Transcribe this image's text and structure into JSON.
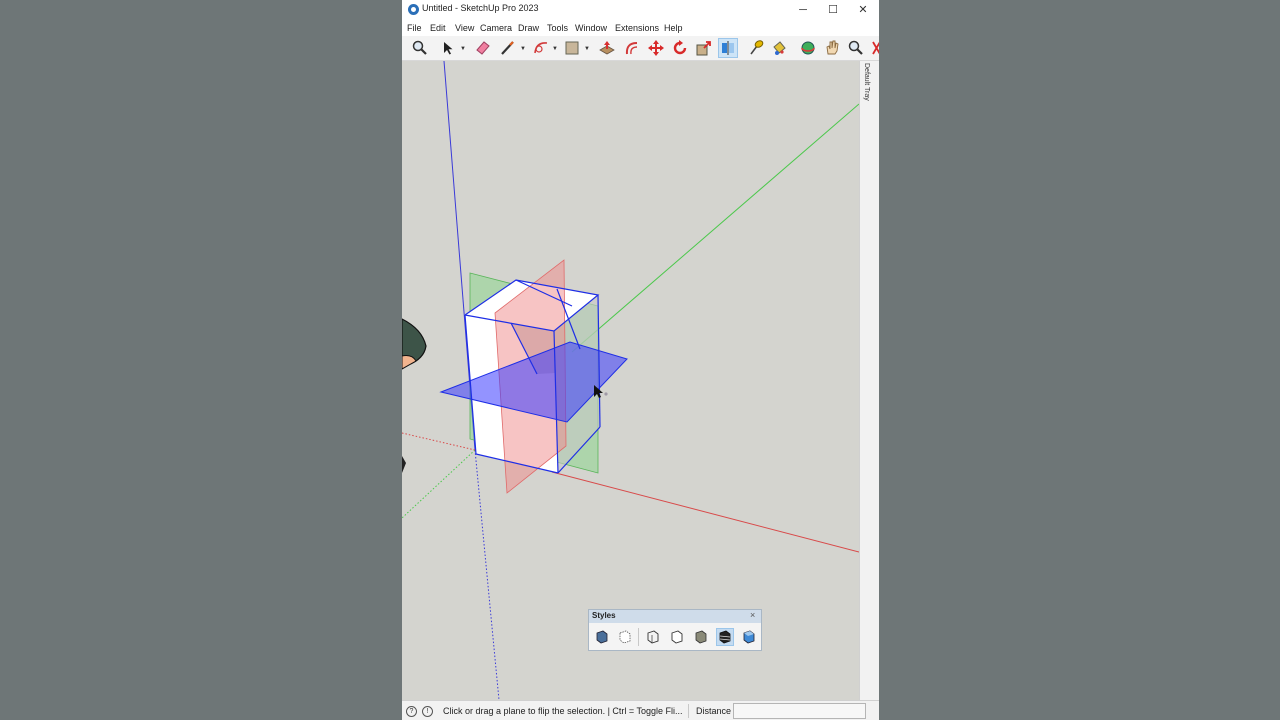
{
  "window": {
    "title": "Untitled - SketchUp Pro 2023",
    "minimize_glyph": "─",
    "maximize_glyph": "☐",
    "close_glyph": "✕"
  },
  "menu": [
    "File",
    "Edit",
    "View",
    "Camera",
    "Draw",
    "Tools",
    "Window",
    "Extensions",
    "Help"
  ],
  "toolbar": {
    "tools": [
      {
        "name": "zoom-icon"
      },
      {
        "name": "select-icon",
        "dropdown": true
      },
      {
        "name": "eraser-icon"
      },
      {
        "name": "pencil-line-icon",
        "dropdown": true
      },
      {
        "name": "arc-icon",
        "dropdown": true
      },
      {
        "name": "rectangle-icon",
        "dropdown": true
      },
      {
        "name": "push-pull-icon"
      },
      {
        "name": "offset-icon"
      },
      {
        "name": "move-icon"
      },
      {
        "name": "rotate-icon"
      },
      {
        "name": "scale-icon"
      },
      {
        "name": "flip-icon",
        "active": true
      },
      {
        "name": "tape-measure-icon"
      },
      {
        "name": "paint-bucket-icon"
      },
      {
        "name": "orbit-icon"
      },
      {
        "name": "pan-icon"
      },
      {
        "name": "zoom-window-icon"
      },
      {
        "name": "zoom-extents-icon"
      }
    ]
  },
  "tray": {
    "label": "Default Tray"
  },
  "styles_panel": {
    "title": "Styles",
    "close_glyph": "×",
    "buttons": [
      {
        "name": "xray-style-icon"
      },
      {
        "name": "back-edges-style-icon"
      },
      {
        "name": "wireframe-style-icon"
      },
      {
        "name": "hidden-line-style-icon"
      },
      {
        "name": "shaded-style-icon"
      },
      {
        "name": "shaded-textures-style-icon",
        "active": true
      },
      {
        "name": "monochrome-style-icon"
      }
    ]
  },
  "status": {
    "message": "Click or drag a plane to flip the selection. | Ctrl = Toggle Fli...",
    "measure_label": "Distance",
    "measure_value": "",
    "geo_glyph": "?",
    "info_glyph": "!"
  },
  "colors": {
    "axis_blue": "#3a3ad8",
    "axis_green": "#4cc84c",
    "axis_red": "#d84a4a",
    "selection_edge": "#1e2ee6",
    "flip_plane_blue": "#3b3bff",
    "flip_plane_red": "#f08a8a",
    "flip_plane_green": "#7fd67f"
  }
}
